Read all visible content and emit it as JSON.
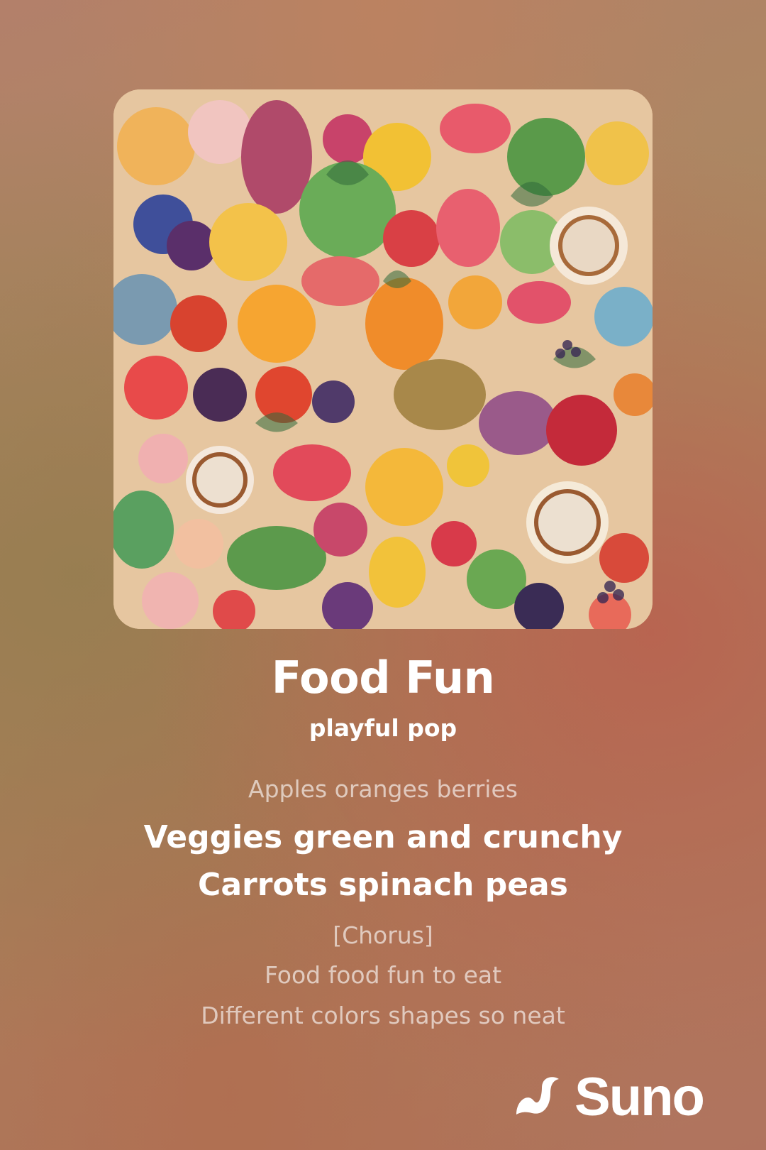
{
  "song": {
    "title": "Food Fun",
    "style": "playful pop"
  },
  "lyrics": [
    {
      "text": "Apples oranges berries",
      "active": false
    },
    {
      "text": "Veggies green and crunchy",
      "active": true
    },
    {
      "text": "Carrots spinach peas",
      "active": true
    },
    {
      "text": "[Chorus]",
      "active": false
    },
    {
      "text": "Food food fun to eat",
      "active": false
    },
    {
      "text": "Different colors shapes so neat",
      "active": false
    }
  ],
  "brand": {
    "name": "Suno",
    "logo_icon": "suno-wave-icon"
  },
  "colors": {
    "text": "#ffffff",
    "background_warm": "#b3806a",
    "background_olive": "#a98a5f"
  }
}
